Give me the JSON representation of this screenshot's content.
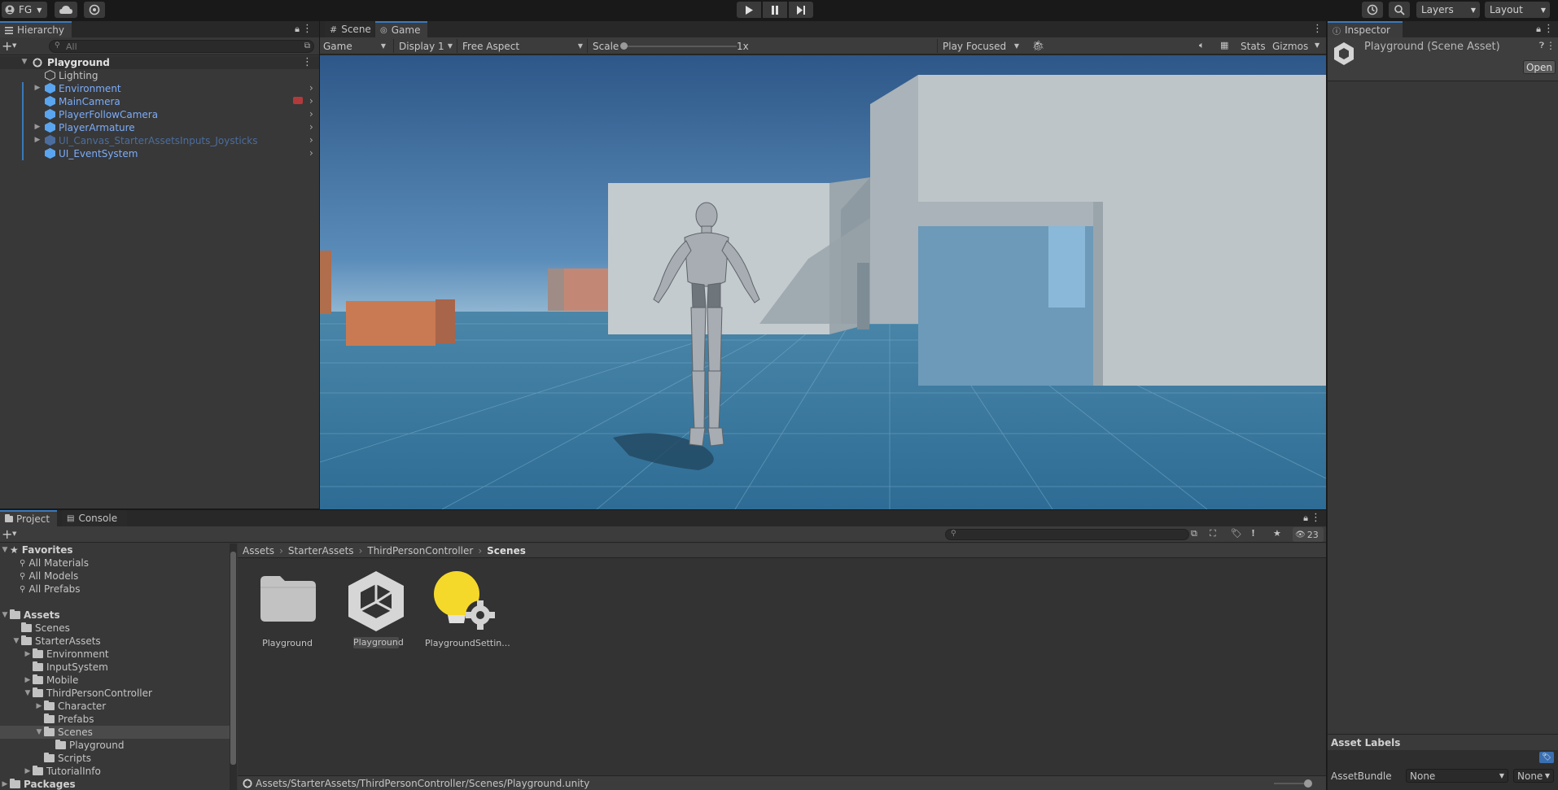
{
  "toolbar": {
    "account": "FG",
    "layers": "Layers",
    "layout": "Layout"
  },
  "hierarchy": {
    "tab": "Hierarchy",
    "search_placeholder": "All",
    "scene": "Playground",
    "items": [
      {
        "label": "Lighting",
        "style": "normal"
      },
      {
        "label": "Environment",
        "style": "prefab"
      },
      {
        "label": "MainCamera",
        "style": "prefab"
      },
      {
        "label": "PlayerFollowCamera",
        "style": "prefab"
      },
      {
        "label": "PlayerArmature",
        "style": "prefab"
      },
      {
        "label": "UI_Canvas_StarterAssetsInputs_Joysticks",
        "style": "faded"
      },
      {
        "label": "UI_EventSystem",
        "style": "prefab"
      }
    ]
  },
  "game_view": {
    "tabs": [
      "Scene",
      "Game"
    ],
    "mode": "Game",
    "display": "Display 1",
    "aspect": "Free Aspect",
    "scale_label": "Scale",
    "scale_value": "1x",
    "play_mode": "Play Focused",
    "stats": "Stats",
    "gizmos": "Gizmos"
  },
  "inspector": {
    "tab": "Inspector",
    "title": "Playground (Scene Asset)",
    "open_button": "Open",
    "asset_labels": "Asset Labels",
    "asset_bundle_label": "AssetBundle",
    "asset_bundle_value": "None",
    "asset_variant_value": "None"
  },
  "project": {
    "tabs": [
      "Project",
      "Console"
    ],
    "hidden_count": "23",
    "breadcrumb": [
      "Assets",
      "StarterAssets",
      "ThirdPersonController",
      "Scenes"
    ],
    "favorites": {
      "title": "Favorites",
      "items": [
        "All Materials",
        "All Models",
        "All Prefabs"
      ]
    },
    "tree": [
      {
        "label": "Assets",
        "bold": true
      },
      {
        "label": "Scenes"
      },
      {
        "label": "StarterAssets"
      },
      {
        "label": "Environment"
      },
      {
        "label": "InputSystem"
      },
      {
        "label": "Mobile"
      },
      {
        "label": "ThirdPersonController"
      },
      {
        "label": "Character"
      },
      {
        "label": "Prefabs"
      },
      {
        "label": "Scenes"
      },
      {
        "label": "Playground"
      },
      {
        "label": "Scripts"
      },
      {
        "label": "TutorialInfo"
      },
      {
        "label": "Packages",
        "bold": true
      }
    ],
    "assets": [
      {
        "label": "Playground",
        "type": "folder"
      },
      {
        "label": "Playground",
        "type": "scene"
      },
      {
        "label": "PlaygroundSettin...",
        "type": "lighting"
      }
    ],
    "status_path": "Assets/StarterAssets/ThirdPersonController/Scenes/Playground.unity"
  }
}
